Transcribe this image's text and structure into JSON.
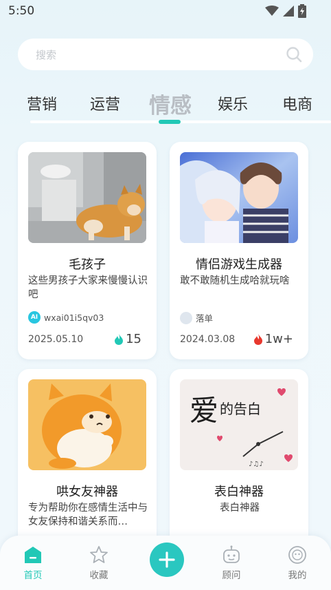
{
  "status_bar": {
    "time": "5:50"
  },
  "search": {
    "placeholder": "搜索"
  },
  "tabs": [
    {
      "label": "营销",
      "active": false
    },
    {
      "label": "运营",
      "active": false
    },
    {
      "label": "情感",
      "active": true
    },
    {
      "label": "娱乐",
      "active": false
    },
    {
      "label": "电商",
      "active": false
    }
  ],
  "cards": [
    {
      "title": "毛孩子",
      "description": "这些男孩子大家来慢慢认识吧",
      "author": "wxai01i5qv03",
      "author_avatar_text": "AI",
      "date": "2025.05.10",
      "heat": "15",
      "heat_color": "#21c8b6",
      "image_icon": "shiba-dog-image"
    },
    {
      "title": "情侣游戏生成器",
      "description": "敢不敢随机生成哈就玩啥",
      "author": "落单",
      "date": "2024.03.08",
      "heat": "1w+",
      "heat_color": "#e8382e",
      "image_icon": "anime-couple-image"
    },
    {
      "title": "哄女友神器",
      "description": "专为帮助你在感情生活中与女友保持和谐关系而…",
      "image_icon": "plush-hamster-image"
    },
    {
      "title": "表白神器",
      "description": "表白神器",
      "image_icon": "love-confession-image",
      "image_text_big": "爱",
      "image_text_small": "的告白"
    }
  ],
  "bottom_nav": [
    {
      "label": "首页",
      "icon": "home-icon",
      "active": true
    },
    {
      "label": "收藏",
      "icon": "star-icon",
      "active": false
    },
    {
      "label": "",
      "icon": "plus-icon",
      "active": false
    },
    {
      "label": "顾问",
      "icon": "robot-icon",
      "active": false
    },
    {
      "label": "我的",
      "icon": "smiley-icon",
      "active": false
    }
  ],
  "colors": {
    "accent": "#21c8b6",
    "inactive_tab": "#b9bec4",
    "hot": "#e8382e"
  }
}
